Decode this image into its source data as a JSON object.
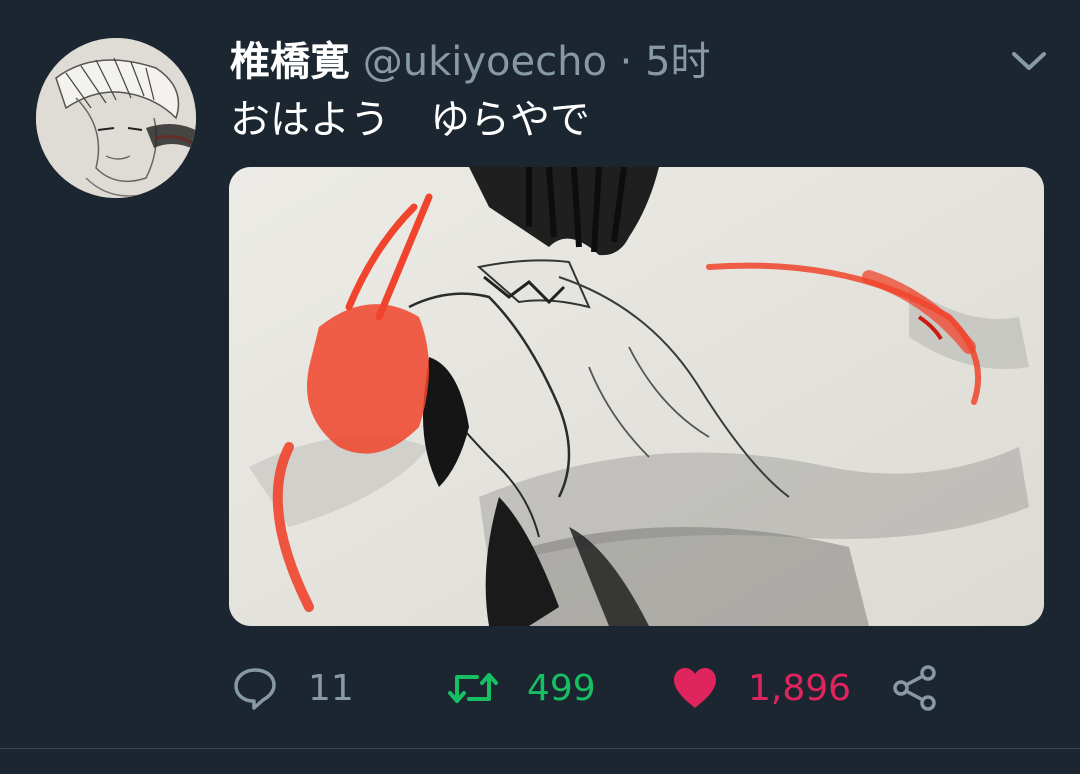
{
  "tweet": {
    "author": {
      "display_name": "椎橋寛",
      "handle": "@ukiyoecho",
      "avatar_icon": "avatar-sketch"
    },
    "separator": "·",
    "time": "5时",
    "text": "おはよう　ゆらやで",
    "media": {
      "type": "ink-sketch-illustration",
      "accent_color": "#f0442c"
    },
    "actions": {
      "reply": {
        "icon": "reply-bubble-icon",
        "count": "11"
      },
      "retweet": {
        "icon": "retweet-icon",
        "count": "499",
        "color": "#17bf63"
      },
      "like": {
        "icon": "heart-icon",
        "count": "1,896",
        "color": "#e0245e"
      },
      "share": {
        "icon": "share-icon"
      }
    },
    "menu_icon": "chevron-down-icon"
  },
  "theme": {
    "background": "#1b2631",
    "secondary_text": "#8899a6",
    "primary_text": "#ffffff"
  }
}
